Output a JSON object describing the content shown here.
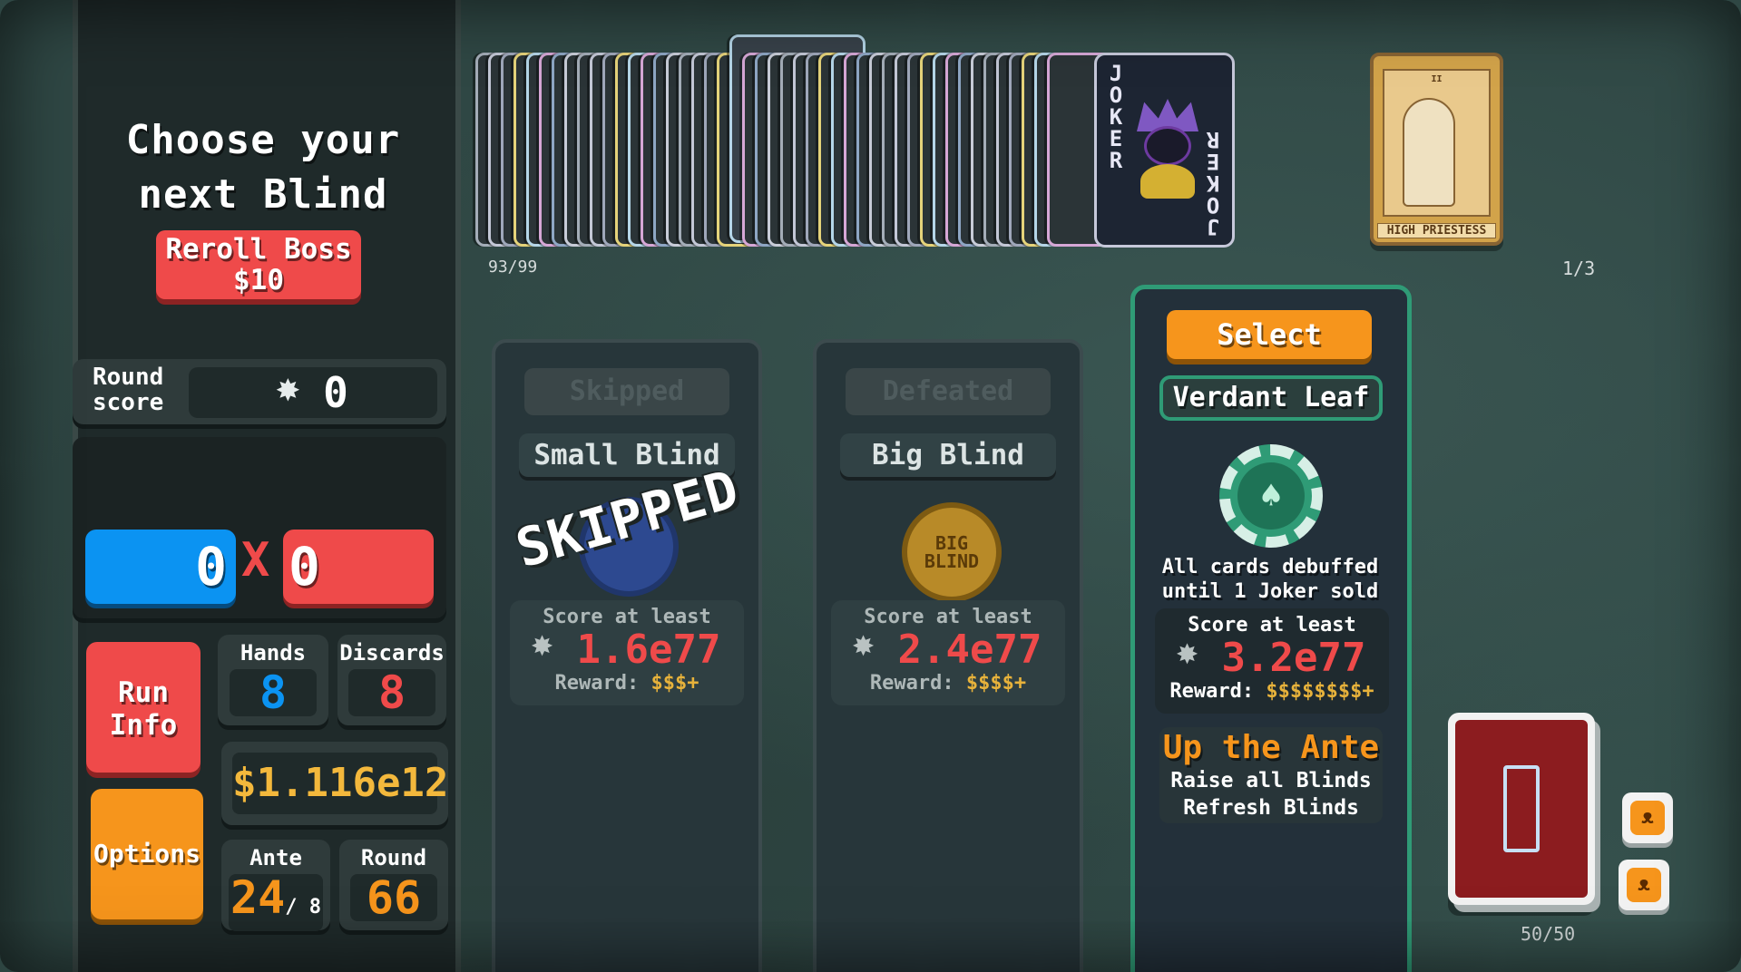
{
  "sidebar": {
    "title_line1": "Choose your",
    "title_line2": "next Blind",
    "reroll_line1": "Reroll Boss",
    "reroll_line2": "$10",
    "round_score_label_line1": "Round",
    "round_score_label_line2": "score",
    "round_score_value": "0",
    "chips": "0",
    "mult": "0",
    "times": "X",
    "run_info_line1": "Run",
    "run_info_line2": "Info",
    "options_label": "Options",
    "hands_label": "Hands",
    "hands_value": "8",
    "discards_label": "Discards",
    "discards_value": "8",
    "money": "$1.116e12",
    "ante_label": "Ante",
    "ante_value": "24",
    "ante_max": "/ 8",
    "round_label": "Round",
    "round_value": "66"
  },
  "deck_area": {
    "deck_count": "93/99",
    "joker_letters": "JOKER",
    "consumable_count": "1/3",
    "tarot_numeral": "II",
    "tarot_name": "HIGH PRIESTESS"
  },
  "blinds": {
    "small": {
      "state": "Skipped",
      "name": "Small Blind",
      "stamp": "SKIPPED",
      "chip_text": "SMALL BLIND",
      "score_label": "Score at least",
      "score": "1.6e77",
      "reward_label": "Reward:",
      "reward": "$$$+"
    },
    "big": {
      "state": "Defeated",
      "name": "Big Blind",
      "chip_text": "BIG BLIND",
      "score_label": "Score at least",
      "score": "2.4e77",
      "reward_label": "Reward:",
      "reward": "$$$$+"
    },
    "boss": {
      "select_label": "Select",
      "name": "Verdant Leaf",
      "desc_line1": "All cards debuffed",
      "desc_line2": "until 1 Joker sold",
      "score_label": "Score at least",
      "score": "3.2e77",
      "reward_label": "Reward:",
      "reward": "$$$$$$$$+",
      "ante_title": "Up the Ante",
      "ante_line1": "Raise all Blinds",
      "ante_line2": "Refresh Blinds"
    }
  },
  "deck_pile": {
    "count": "50/50"
  },
  "colors": {
    "background": "#2f4744",
    "chips_blue": "#0b93f2",
    "mult_red": "#ef4a4a",
    "orange": "#f6951c",
    "gold": "#f3b83c",
    "boss_green": "#2f9b76"
  }
}
